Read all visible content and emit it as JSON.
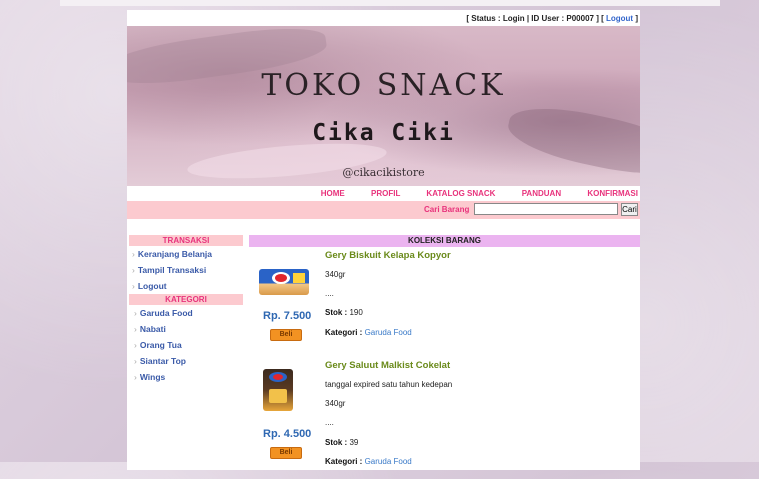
{
  "status": {
    "text": "[ Status : Login | ID User : P00007 ] [",
    "logout": "Logout",
    "close": "]"
  },
  "banner": {
    "title": "TOKO SNACK",
    "subtitle": "Cika Ciki",
    "tagline": "@cikacikistore"
  },
  "nav": [
    "HOME",
    "PROFIL",
    "KATALOG SNACK",
    "PANDUAN",
    "KONFIRMASI"
  ],
  "search": {
    "label": "Cari Barang",
    "value": "",
    "button": "Cari"
  },
  "sidebar": {
    "transaksi_title": "TRANSAKSI",
    "transaksi": [
      "Keranjang Belanja",
      "Tampil Transaksi",
      "Logout"
    ],
    "kategori_title": "KATEGORI",
    "kategori": [
      "Garuda Food",
      "Nabati",
      "Orang Tua",
      "Siantar Top",
      "Wings"
    ]
  },
  "collection_title": "KOLEKSI BARANG",
  "products": [
    {
      "name": "Gery Biskuit Kelapa Kopyor",
      "lines": [
        "340gr",
        "...."
      ],
      "stok_label": "Stok :",
      "stok": "190",
      "kategori_label": "Kategori :",
      "kategori": "Garuda Food",
      "price": "Rp. 7.500",
      "buy": "Beli"
    },
    {
      "name": "Gery Saluut Malkist Cokelat",
      "lines": [
        "tanggal expired satu tahun kedepan",
        "340gr",
        "...."
      ],
      "stok_label": "Stok :",
      "stok": "39",
      "kategori_label": "Kategori :",
      "kategori": "Garuda Food",
      "price": "Rp. 4.500",
      "buy": "Beli"
    }
  ],
  "colors": {
    "accent": "#e8337c",
    "pink_bar": "#fccacf",
    "purple_bar": "#ebb4f0",
    "link": "#3a5aa8",
    "product_name": "#6a8a1a",
    "price": "#2f68b2",
    "beli": "#f29222"
  }
}
